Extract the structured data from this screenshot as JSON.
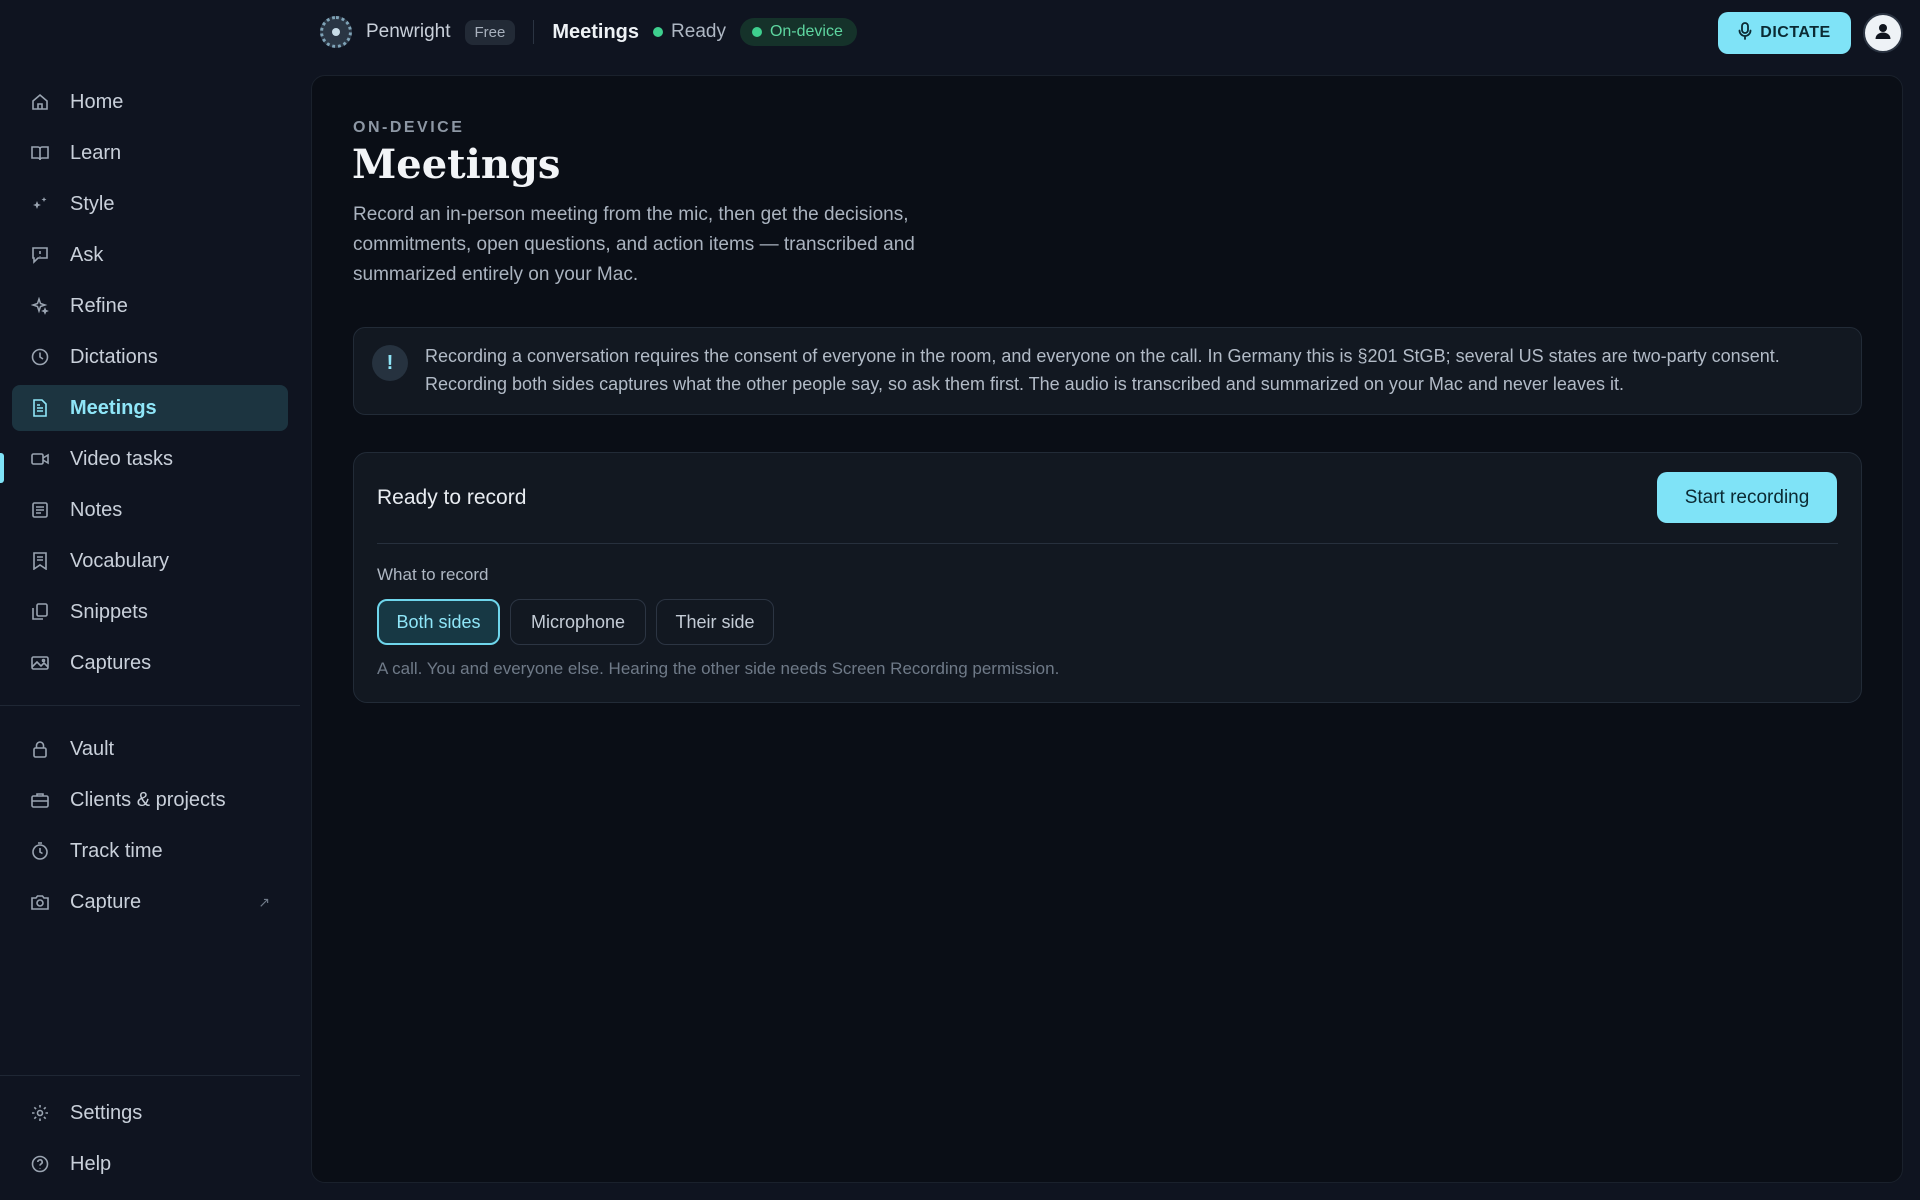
{
  "app": {
    "name": "Penwright",
    "plan": "Free",
    "page": "Meetings",
    "status": "Ready",
    "mode_badge": "On-device",
    "dictate_label": "DICTATE"
  },
  "sidebar": {
    "items": [
      {
        "label": "Home",
        "icon": "home-icon"
      },
      {
        "label": "Learn",
        "icon": "book-icon"
      },
      {
        "label": "Style",
        "icon": "sparkle-icon"
      },
      {
        "label": "Ask",
        "icon": "chat-icon"
      },
      {
        "label": "Refine",
        "icon": "stars-icon"
      },
      {
        "label": "Dictations",
        "icon": "clock-icon"
      },
      {
        "label": "Meetings",
        "icon": "document-icon"
      },
      {
        "label": "Video tasks",
        "icon": "video-icon"
      },
      {
        "label": "Notes",
        "icon": "notes-icon"
      },
      {
        "label": "Vocabulary",
        "icon": "bookmark-icon"
      },
      {
        "label": "Snippets",
        "icon": "copy-icon"
      },
      {
        "label": "Captures",
        "icon": "image-icon"
      }
    ],
    "secondary": [
      {
        "label": "Vault",
        "icon": "lock-icon"
      },
      {
        "label": "Clients & projects",
        "icon": "briefcase-icon"
      },
      {
        "label": "Track time",
        "icon": "stopwatch-icon"
      },
      {
        "label": "Capture",
        "icon": "camera-icon",
        "external_indicator": "↗"
      }
    ],
    "footer": [
      {
        "label": "Settings",
        "icon": "gear-icon"
      },
      {
        "label": "Help",
        "icon": "help-icon"
      }
    ],
    "active": "Meetings"
  },
  "main": {
    "eyebrow": "ON-DEVICE",
    "title": "Meetings",
    "description": "Record an in-person meeting from the mic, then get the decisions, commitments, open questions, and action items — transcribed and summarized entirely on your Mac.",
    "notice": {
      "icon": "!",
      "text": "Recording a conversation requires the consent of everyone in the room, and everyone on the call. In Germany this is §201 StGB; several US states are two-party consent. Recording both sides captures what the other people say, so ask them first. The audio is transcribed and summarized on your Mac and never leaves it."
    },
    "record": {
      "title": "Ready to record",
      "start_label": "Start recording",
      "what_label": "What to record",
      "options": [
        "Both sides",
        "Microphone",
        "Their side"
      ],
      "selected": "Both sides",
      "hint": "A call. You and everyone else. Hearing the other side needs Screen Recording permission."
    }
  },
  "colors": {
    "accent": "#7fe3f7",
    "status_green": "#3ecf8e",
    "background": "#0f1420",
    "panel": "#0a0e16"
  }
}
